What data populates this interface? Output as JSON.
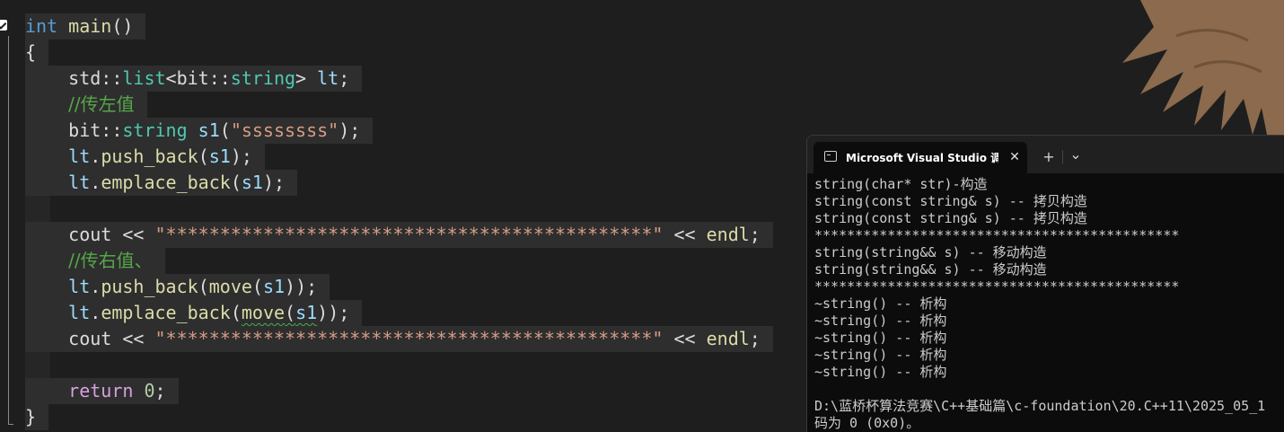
{
  "editor": {
    "lines": [
      [
        {
          "t": "int",
          "c": "kw"
        },
        {
          "t": " ",
          "c": "pu"
        },
        {
          "t": "main",
          "c": "fn"
        },
        {
          "t": "()",
          "c": "pu"
        }
      ],
      [
        {
          "t": "{",
          "c": "pu"
        }
      ],
      [
        {
          "t": "    std::",
          "c": "pu"
        },
        {
          "t": "list",
          "c": "ty"
        },
        {
          "t": "<bit::",
          "c": "pu"
        },
        {
          "t": "string",
          "c": "ty"
        },
        {
          "t": "> ",
          "c": "pu"
        },
        {
          "t": "lt",
          "c": "vr"
        },
        {
          "t": ";",
          "c": "pu"
        }
      ],
      [
        {
          "t": "    ",
          "c": "pu"
        },
        {
          "t": "//传左值",
          "c": "cm"
        }
      ],
      [
        {
          "t": "    bit::",
          "c": "pu"
        },
        {
          "t": "string",
          "c": "ty"
        },
        {
          "t": " ",
          "c": "pu"
        },
        {
          "t": "s1",
          "c": "vr"
        },
        {
          "t": "(",
          "c": "pu"
        },
        {
          "t": "\"ssssssss\"",
          "c": "st"
        },
        {
          "t": ");",
          "c": "pu"
        }
      ],
      [
        {
          "t": "    ",
          "c": "pu"
        },
        {
          "t": "lt",
          "c": "vr"
        },
        {
          "t": ".",
          "c": "pu"
        },
        {
          "t": "push_back",
          "c": "fn"
        },
        {
          "t": "(",
          "c": "pu"
        },
        {
          "t": "s1",
          "c": "vr"
        },
        {
          "t": ");",
          "c": "pu"
        }
      ],
      [
        {
          "t": "    ",
          "c": "pu"
        },
        {
          "t": "lt",
          "c": "vr"
        },
        {
          "t": ".",
          "c": "pu"
        },
        {
          "t": "emplace_back",
          "c": "fn"
        },
        {
          "t": "(",
          "c": "pu"
        },
        {
          "t": "s1",
          "c": "vr"
        },
        {
          "t": ");",
          "c": "pu"
        }
      ],
      [],
      [
        {
          "t": "    cout << ",
          "c": "pu"
        },
        {
          "t": "\"*********************************************\"",
          "c": "st"
        },
        {
          "t": " << ",
          "c": "pu"
        },
        {
          "t": "endl",
          "c": "fn"
        },
        {
          "t": ";",
          "c": "pu"
        }
      ],
      [
        {
          "t": "    ",
          "c": "pu"
        },
        {
          "t": "//传右值、",
          "c": "cm"
        }
      ],
      [
        {
          "t": "    ",
          "c": "pu"
        },
        {
          "t": "lt",
          "c": "vr"
        },
        {
          "t": ".",
          "c": "pu"
        },
        {
          "t": "push_back",
          "c": "fn"
        },
        {
          "t": "(",
          "c": "pu"
        },
        {
          "t": "move",
          "c": "fn"
        },
        {
          "t": "(",
          "c": "pu"
        },
        {
          "t": "s1",
          "c": "vr"
        },
        {
          "t": "));",
          "c": "pu"
        }
      ],
      [
        {
          "t": "    ",
          "c": "pu"
        },
        {
          "t": "lt",
          "c": "vr"
        },
        {
          "t": ".",
          "c": "pu"
        },
        {
          "t": "emplace_back",
          "c": "fn"
        },
        {
          "t": "(",
          "c": "pu"
        },
        {
          "t": "move",
          "c": "fn",
          "sq": true
        },
        {
          "t": "(",
          "c": "pu",
          "sq": true
        },
        {
          "t": "s1",
          "c": "vr",
          "sq": true
        },
        {
          "t": "));",
          "c": "pu"
        }
      ],
      [
        {
          "t": "    cout << ",
          "c": "pu"
        },
        {
          "t": "\"*********************************************\"",
          "c": "st"
        },
        {
          "t": " << ",
          "c": "pu"
        },
        {
          "t": "endl",
          "c": "fn"
        },
        {
          "t": ";",
          "c": "pu"
        }
      ],
      [],
      [
        {
          "t": "    ",
          "c": "pu"
        },
        {
          "t": "return",
          "c": "ctl"
        },
        {
          "t": " ",
          "c": "pu"
        },
        {
          "t": "0",
          "c": "nm"
        },
        {
          "t": ";",
          "c": "pu"
        }
      ],
      [
        {
          "t": "}",
          "c": "pu"
        }
      ]
    ]
  },
  "terminal": {
    "tab_title": "Microsoft Visual Studio 调试控制台",
    "close_glyph": "✕",
    "new_tab_glyph": "+",
    "dropdown_glyph": "⌄",
    "output": [
      "string(char* str)-构造",
      "string(const string& s) -- 拷贝构造",
      "string(const string& s) -- 拷贝构造",
      "*********************************************",
      "string(string&& s) -- 移动构造",
      "string(string&& s) -- 移动构造",
      "*********************************************",
      "~string() -- 析构",
      "~string() -- 析构",
      "~string() -- 析构",
      "~string() -- 析构",
      "~string() -- 析构",
      "",
      "D:\\蓝桥杯算法竞赛\\C++基础篇\\c-foundation\\20.C++11\\2025_05_1",
      "码为 0 (0x0)。"
    ]
  },
  "colors": {
    "background": "#1e1e1e",
    "terminal_bg": "#0c0c0c",
    "hair": "#8b6a4d"
  }
}
